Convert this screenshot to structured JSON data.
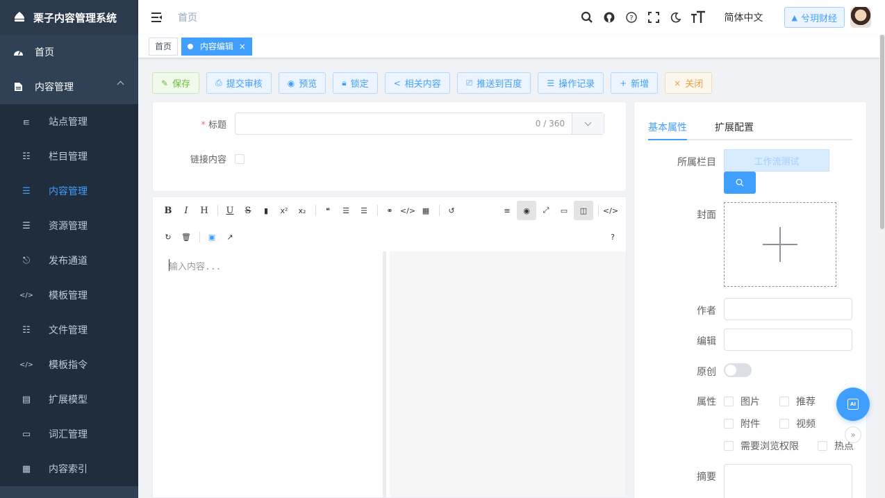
{
  "app": {
    "title": "栗子内容管理系统"
  },
  "sidebar": {
    "items": [
      {
        "label": "首页",
        "icon": "dashboard-icon"
      },
      {
        "label": "内容管理",
        "icon": "document-icon",
        "expanded": true
      }
    ],
    "submenu": [
      {
        "label": "站点管理",
        "icon": "site-icon"
      },
      {
        "label": "栏目管理",
        "icon": "tree-icon"
      },
      {
        "label": "内容管理",
        "icon": "list-icon",
        "active": true
      },
      {
        "label": "资源管理",
        "icon": "list-icon"
      },
      {
        "label": "发布通道",
        "icon": "publish-icon"
      },
      {
        "label": "模板管理",
        "icon": "code-icon"
      },
      {
        "label": "文件管理",
        "icon": "tree-icon"
      },
      {
        "label": "模板指令",
        "icon": "code-icon"
      },
      {
        "label": "扩展模型",
        "icon": "model-icon"
      },
      {
        "label": "词汇管理",
        "icon": "tag-icon"
      },
      {
        "label": "内容索引",
        "icon": "document-icon"
      }
    ]
  },
  "header": {
    "breadcrumb": "首页",
    "language": "简体中文",
    "site": "兮玥财经"
  },
  "tags": [
    {
      "label": "首页",
      "active": false
    },
    {
      "label": "内容编辑",
      "active": true
    }
  ],
  "actions": [
    {
      "label": "保存",
      "icon": "✎",
      "style": "green"
    },
    {
      "label": "提交审核",
      "icon": "⎙",
      "style": "blue"
    },
    {
      "label": "预览",
      "icon": "◉",
      "style": "blue"
    },
    {
      "label": "锁定",
      "icon": "🔒︎",
      "style": "blue"
    },
    {
      "label": "相关内容",
      "icon": "<",
      "style": "blue"
    },
    {
      "label": "推送到百度",
      "icon": "⎚",
      "style": "blue"
    },
    {
      "label": "操作记录",
      "icon": "☰",
      "style": "blue"
    },
    {
      "label": "新增",
      "icon": "+",
      "style": "blue"
    },
    {
      "label": "关闭",
      "icon": "×",
      "style": "orange"
    }
  ],
  "form": {
    "title_label": "标题",
    "title_required": "*",
    "title_count": "0 / 360",
    "link_label": "链接内容"
  },
  "editor": {
    "placeholder": "输入内容..."
  },
  "panel": {
    "tabs": [
      "基本属性",
      "扩展配置"
    ],
    "catalog_label": "所属栏目",
    "catalog_value": "工作流测试",
    "cover_label": "封面",
    "author_label": "作者",
    "editor_label": "编辑",
    "original_label": "原创",
    "attr_label": "属性",
    "attrs": [
      "图片",
      "推荐",
      "附件",
      "视频",
      "需要浏览权限",
      "热点"
    ],
    "summary_label": "摘要"
  },
  "fab": {
    "label": "AI"
  },
  "colors": {
    "primary": "#409eff",
    "sidebar": "#304156",
    "success": "#67c23a",
    "warning": "#e6a23c"
  }
}
